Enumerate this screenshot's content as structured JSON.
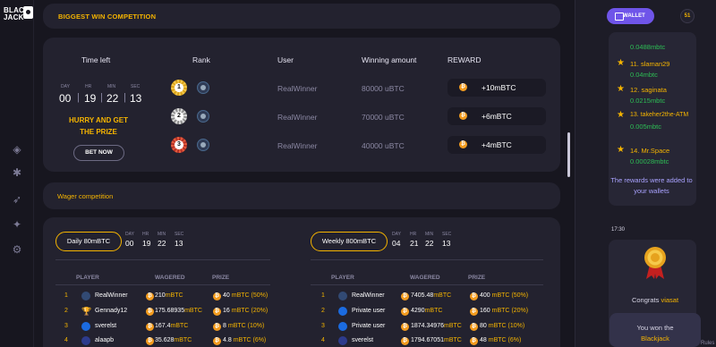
{
  "logo": {
    "text_top": "BLACK",
    "text_bottom": "JACK"
  },
  "nav": {
    "icons": [
      "dice-icon",
      "gear-cluster-icon",
      "rocket-icon",
      "magic-icon",
      "settings-icon"
    ]
  },
  "biggest_win": {
    "title": "BIGGEST WIN COMPETITION",
    "headers": {
      "time": "Time left",
      "rank": "Rank",
      "user": "User",
      "amount": "Winning amount",
      "reward": "REWARD"
    },
    "countdown": {
      "labels": [
        "DAY",
        "HR",
        "MIN",
        "SEC"
      ],
      "values": [
        "00",
        "19",
        "22",
        "13"
      ]
    },
    "hurry_line1": "HURRY AND GET",
    "hurry_line2": "THE PRIZE",
    "bet_button": "BET NOW",
    "rows": [
      {
        "rank": "1",
        "user": "RealWinner",
        "amount": "80000 uBTC",
        "reward": "+10mBTC"
      },
      {
        "rank": "2",
        "user": "RealWinner",
        "amount": "70000 uBTC",
        "reward": "+6mBTC"
      },
      {
        "rank": "3",
        "user": "RealWinner",
        "amount": "40000 uBTC",
        "reward": "+4mBTC"
      }
    ]
  },
  "wager": {
    "title": "Wager competition",
    "daily": {
      "label": "Daily 80mBTC",
      "countdown": {
        "labels": [
          "DAY",
          "HR",
          "MIN",
          "SEC"
        ],
        "values": [
          "00",
          "19",
          "22",
          "13"
        ]
      },
      "columns": [
        "PLAYER",
        "WAGERED",
        "PRIZE"
      ],
      "rows": [
        {
          "n": "1",
          "name": "RealWinner",
          "wagered": "210",
          "prize": "40",
          "pct": "(50%)"
        },
        {
          "n": "2",
          "name": "Gennady12",
          "wagered": "175.68935",
          "prize": "16",
          "pct": "(20%)"
        },
        {
          "n": "3",
          "name": "sverelst",
          "wagered": "167.4",
          "prize": "8",
          "pct": "(10%)"
        },
        {
          "n": "4",
          "name": "alaapb",
          "wagered": "35.628",
          "prize": "4.8",
          "pct": "(6%)"
        }
      ]
    },
    "weekly": {
      "label": "Weekly 800mBTC",
      "countdown": {
        "labels": [
          "DAY",
          "HR",
          "MIN",
          "SEC"
        ],
        "values": [
          "04",
          "21",
          "22",
          "13"
        ]
      },
      "columns": [
        "PLAYER",
        "WAGERED",
        "PRIZE"
      ],
      "rows": [
        {
          "n": "1",
          "name": "RealWinner",
          "wagered": "7405.48",
          "prize": "400",
          "pct": "(50%)"
        },
        {
          "n": "2",
          "name": "Private user",
          "wagered": "4290",
          "prize": "160",
          "pct": "(20%)"
        },
        {
          "n": "3",
          "name": "Private user",
          "wagered": "1874.34976",
          "prize": "80",
          "pct": "(10%)"
        },
        {
          "n": "4",
          "name": "sverelst",
          "wagered": "1794.67051",
          "prize": "48",
          "pct": "(6%)"
        }
      ]
    },
    "unit": "mBTC"
  },
  "chat": {
    "wallet_button": "WALLET",
    "online_count": "51",
    "leaderboard": [
      {
        "name": "",
        "value": "0.0488mbtc"
      },
      {
        "name": "11. slaman29",
        "value": "0.04mbtc"
      },
      {
        "name": "12. saginata",
        "value": "0.0215mbtc"
      },
      {
        "name": "13. takeher2the-ATM",
        "value": "0.005mbtc"
      },
      {
        "name": "14. Mr.Space",
        "value": "0.00028mbtc"
      }
    ],
    "rewards_note": "The rewards were added to your wallets",
    "timestamp": "17:30",
    "congrats_prefix": "Congrats",
    "congrats_user": "viasat",
    "won_line1": "You won the",
    "won_line2": "Blackjack",
    "rules_link": "Rules"
  },
  "colors": {
    "accent": "#f5b400",
    "wallet": "#6f55e9",
    "panel": "#23222f",
    "green": "#2dbf55"
  }
}
